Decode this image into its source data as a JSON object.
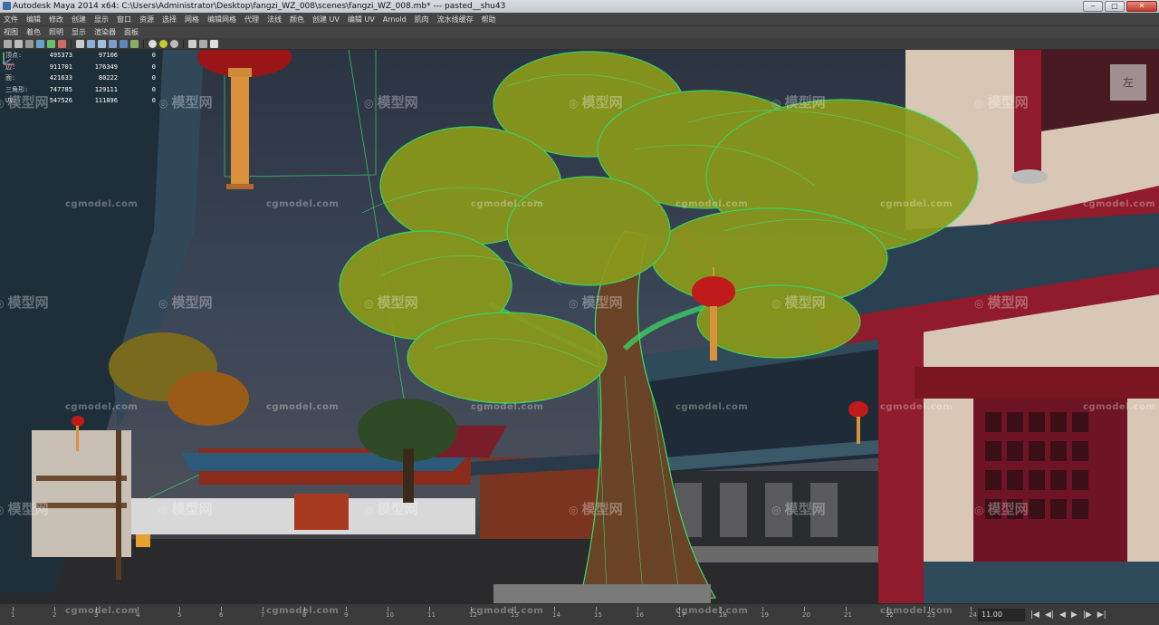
{
  "window": {
    "title": "Autodesk Maya 2014 x64: C:\\Users\\Administrator\\Desktop\\fangzi_WZ_008\\scenes\\fangzi_WZ_008.mb*   ---   pasted__shu43",
    "minimize": "‒",
    "maximize": "□",
    "close": "✕"
  },
  "menubar": [
    "文件",
    "编辑",
    "修改",
    "创建",
    "显示",
    "窗口",
    "资源",
    "选择",
    "网格",
    "编辑网格",
    "代理",
    "法线",
    "颜色",
    "创建 UV",
    "编辑 UV",
    "Arnold",
    "肌肉",
    "流水线缓存",
    "帮助"
  ],
  "panel_menu": [
    "视图",
    "着色",
    "照明",
    "显示",
    "渲染器",
    "面板"
  ],
  "hud": {
    "rows": [
      {
        "label": "顶点:",
        "a": "495373",
        "b": "97106",
        "c": "0"
      },
      {
        "label": "边:",
        "a": "911701",
        "b": "176349",
        "c": "0"
      },
      {
        "label": "面:",
        "a": "421633",
        "b": "80222",
        "c": "0"
      },
      {
        "label": "三角形:",
        "a": "747785",
        "b": "129111",
        "c": "0"
      },
      {
        "label": "UV:",
        "a": "547526",
        "b": "111896",
        "c": "0"
      }
    ]
  },
  "watermarks": {
    "cg_text": "cgmodel.com",
    "logo_text": "模型网"
  },
  "viewcube": {
    "label": "左"
  },
  "timeline": {
    "ticks": [
      "1",
      "2",
      "3",
      "4",
      "5",
      "6",
      "7",
      "8",
      "9",
      "10",
      "11",
      "12",
      "13",
      "14",
      "15",
      "16",
      "17",
      "18",
      "19",
      "20",
      "21",
      "22",
      "23",
      "24"
    ],
    "current_frame": "11.00",
    "buttons": [
      "|◀",
      "◀|",
      "◀",
      "▶",
      "|▶",
      "▶|"
    ]
  },
  "colors": {
    "wire_green": "#39e06a",
    "leaf": "#8a9a1a",
    "lantern": "#c01a1a",
    "beam": "#8f1b2c",
    "roof": "#2f4a5a",
    "sky": "#3a4556"
  },
  "icons": [
    "select-icon",
    "lasso-icon",
    "paint-icon",
    "move-icon",
    "rotate-icon",
    "scale-icon",
    "camera-icon",
    "grid-icon",
    "wireframe-icon",
    "smooth-shade-icon",
    "texture-icon",
    "light-icon",
    "shadow-icon",
    "xray-icon",
    "isolate-icon",
    "resolution-gate-icon"
  ]
}
